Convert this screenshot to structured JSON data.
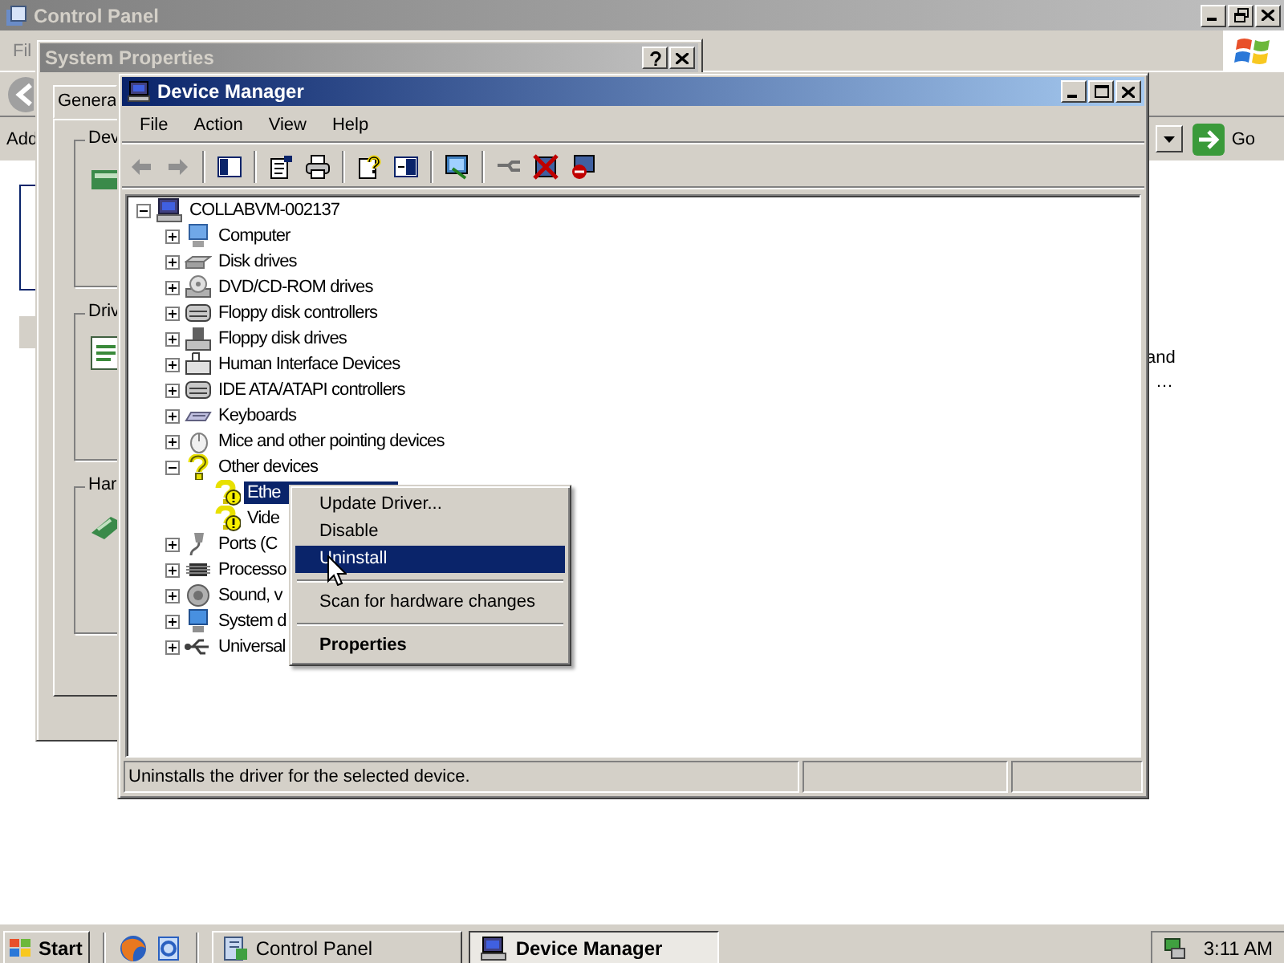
{
  "control_panel": {
    "title": "Control Panel",
    "menu_fragment": "Fil",
    "address_label": "Add",
    "go_button": "Go",
    "text_fragments": [
      "and",
      "…"
    ]
  },
  "system_properties": {
    "title": "System Properties",
    "tab": "Genera",
    "groups": [
      "Dev",
      "Driv",
      "Har"
    ]
  },
  "device_manager": {
    "title": "Device Manager",
    "menu": [
      "File",
      "Action",
      "View",
      "Help"
    ],
    "tree": {
      "label": "COLLABVM-002137",
      "kind": "root",
      "expanded": true,
      "selected": false,
      "children": [
        {
          "label": "Computer",
          "kind": "computer",
          "expanded": false,
          "selected": false
        },
        {
          "label": "Disk drives",
          "kind": "disk",
          "expanded": false,
          "selected": false
        },
        {
          "label": "DVD/CD-ROM drives",
          "kind": "cdrom",
          "expanded": false,
          "selected": false
        },
        {
          "label": "Floppy disk controllers",
          "kind": "controller",
          "expanded": false,
          "selected": false
        },
        {
          "label": "Floppy disk drives",
          "kind": "floppy",
          "expanded": false,
          "selected": false
        },
        {
          "label": "Human Interface Devices",
          "kind": "hid",
          "expanded": false,
          "selected": false
        },
        {
          "label": "IDE ATA/ATAPI controllers",
          "kind": "controller",
          "expanded": false,
          "selected": false
        },
        {
          "label": "Keyboards",
          "kind": "keyboard",
          "expanded": false,
          "selected": false
        },
        {
          "label": "Mice and other pointing devices",
          "kind": "mouse",
          "expanded": false,
          "selected": false
        },
        {
          "label": "Other devices",
          "kind": "unknown",
          "expanded": true,
          "selected": false,
          "children": [
            {
              "label": "Ethe",
              "kind": "warning",
              "selected": true
            },
            {
              "label": "Vide",
              "kind": "warning",
              "selected": false
            }
          ]
        },
        {
          "label": "Ports (C",
          "kind": "port",
          "expanded": false,
          "selected": false
        },
        {
          "label": "Processo",
          "kind": "chip",
          "expanded": false,
          "selected": false
        },
        {
          "label": "Sound, v",
          "kind": "sound",
          "expanded": false,
          "selected": false
        },
        {
          "label": "System d",
          "kind": "system",
          "expanded": false,
          "selected": false
        },
        {
          "label": "Universal",
          "kind": "usb",
          "expanded": false,
          "selected": false
        }
      ]
    },
    "status_bar": "Uninstalls the driver for the selected device."
  },
  "context_menu": {
    "items": [
      {
        "kind": "item",
        "label": "Update Driver...",
        "selected": false,
        "default": false
      },
      {
        "kind": "item",
        "label": "Disable",
        "selected": false,
        "default": false
      },
      {
        "kind": "item",
        "label": "Uninstall",
        "selected": true,
        "default": false
      },
      {
        "kind": "separator"
      },
      {
        "kind": "item",
        "label": "Scan for hardware changes",
        "selected": false,
        "default": false
      },
      {
        "kind": "separator"
      },
      {
        "kind": "item",
        "label": "Properties",
        "selected": false,
        "default": true
      }
    ]
  },
  "taskbar": {
    "start": "Start",
    "tasks": [
      {
        "label": "Control Panel",
        "selected": false
      },
      {
        "label": "Device Manager",
        "selected": true
      }
    ],
    "clock": "3:11 AM"
  }
}
